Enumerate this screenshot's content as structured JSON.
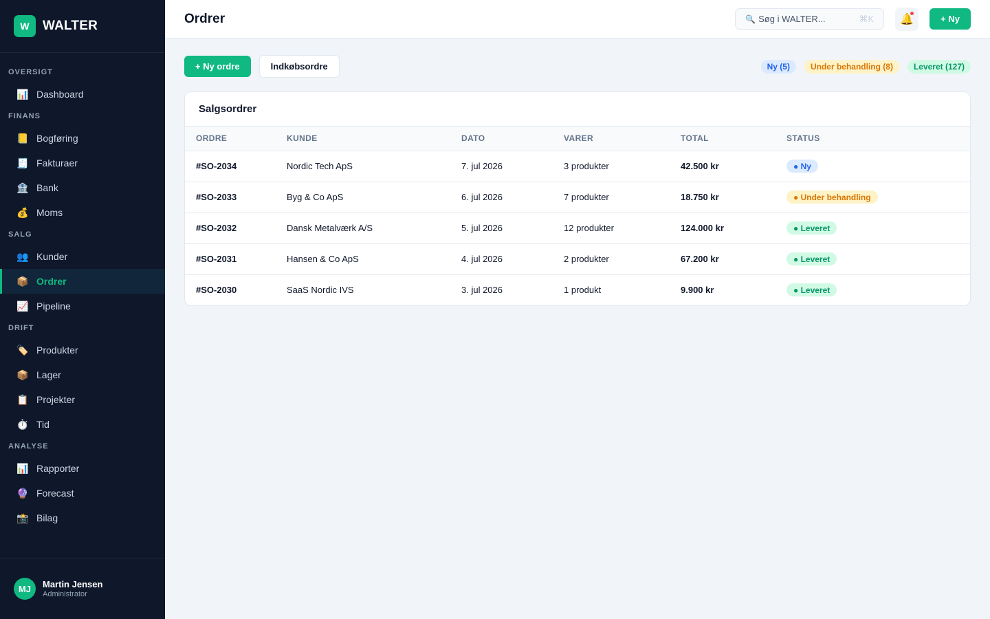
{
  "app": {
    "logo_letter": "W",
    "name": "WALTER"
  },
  "sidebar": {
    "sections": [
      {
        "label": "OVERSIGT",
        "items": [
          {
            "icon": "📊",
            "icon_name": "chart-icon",
            "label": "Dashboard"
          }
        ]
      },
      {
        "label": "FINANS",
        "items": [
          {
            "icon": "📒",
            "icon_name": "ledger-icon",
            "label": "Bogføring"
          },
          {
            "icon": "🧾",
            "icon_name": "receipt-icon",
            "label": "Fakturaer"
          },
          {
            "icon": "🏦",
            "icon_name": "bank-icon",
            "label": "Bank"
          },
          {
            "icon": "💰",
            "icon_name": "money-bag-icon",
            "label": "Moms"
          }
        ]
      },
      {
        "label": "SALG",
        "items": [
          {
            "icon": "👥",
            "icon_name": "people-icon",
            "label": "Kunder"
          },
          {
            "icon": "📦",
            "icon_name": "package-icon",
            "label": "Ordrer",
            "active": true
          },
          {
            "icon": "📈",
            "icon_name": "trend-up-icon",
            "label": "Pipeline"
          }
        ]
      },
      {
        "label": "DRIFT",
        "items": [
          {
            "icon": "🏷️",
            "icon_name": "tag-icon",
            "label": "Produkter"
          },
          {
            "icon": "📦",
            "icon_name": "package-icon",
            "label": "Lager"
          },
          {
            "icon": "📋",
            "icon_name": "clipboard-icon",
            "label": "Projekter"
          },
          {
            "icon": "⏱️",
            "icon_name": "stopwatch-icon",
            "label": "Tid"
          }
        ]
      },
      {
        "label": "ANALYSE",
        "items": [
          {
            "icon": "📊",
            "icon_name": "chart-icon",
            "label": "Rapporter"
          },
          {
            "icon": "🔮",
            "icon_name": "crystal-ball-icon",
            "label": "Forecast"
          },
          {
            "icon": "📸",
            "icon_name": "camera-icon",
            "label": "Bilag"
          }
        ]
      }
    ]
  },
  "user": {
    "initials": "MJ",
    "name": "Martin Jensen",
    "role": "Administrator"
  },
  "header": {
    "title": "Ordrer",
    "search_icon": "🔍",
    "search_placeholder": "Søg i WALTER...",
    "search_shortcut": "⌘K",
    "bell_icon": "🔔",
    "new_label": "+ Ny"
  },
  "toolbar": {
    "new_order_label": "+ Ny ordre",
    "purchase_orders_label": "Indkøbsordre",
    "filters": [
      {
        "label": "Ny (5)",
        "color": "blue"
      },
      {
        "label": "Under behandling (8)",
        "color": "amber"
      },
      {
        "label": "Leveret (127)",
        "color": "green"
      }
    ]
  },
  "orders": {
    "title": "Salgsordrer",
    "columns": [
      "ORDRE",
      "KUNDE",
      "DATO",
      "VARER",
      "TOTAL",
      "STATUS"
    ],
    "rows": [
      {
        "id": "#SO-2034",
        "customer": "Nordic Tech ApS",
        "date": "7. jul 2026",
        "items": "3 produkter",
        "total": "42.500 kr",
        "status": "● Ny",
        "status_color": "blue"
      },
      {
        "id": "#SO-2033",
        "customer": "Byg & Co ApS",
        "date": "6. jul 2026",
        "items": "7 produkter",
        "total": "18.750 kr",
        "status": "● Under behandling",
        "status_color": "amber"
      },
      {
        "id": "#SO-2032",
        "customer": "Dansk Metalværk A/S",
        "date": "5. jul 2026",
        "items": "12 produkter",
        "total": "124.000 kr",
        "status": "● Leveret",
        "status_color": "green"
      },
      {
        "id": "#SO-2031",
        "customer": "Hansen & Co ApS",
        "date": "4. jul 2026",
        "items": "2 produkter",
        "total": "67.200 kr",
        "status": "● Leveret",
        "status_color": "green"
      },
      {
        "id": "#SO-2030",
        "customer": "SaaS Nordic IVS",
        "date": "3. jul 2026",
        "items": "1 produkt",
        "total": "9.900 kr",
        "status": "● Leveret",
        "status_color": "green"
      }
    ]
  },
  "colors": {
    "accent": "#10b981",
    "sidebar_bg": "#0f172a",
    "page_bg": "#f1f5f9"
  }
}
